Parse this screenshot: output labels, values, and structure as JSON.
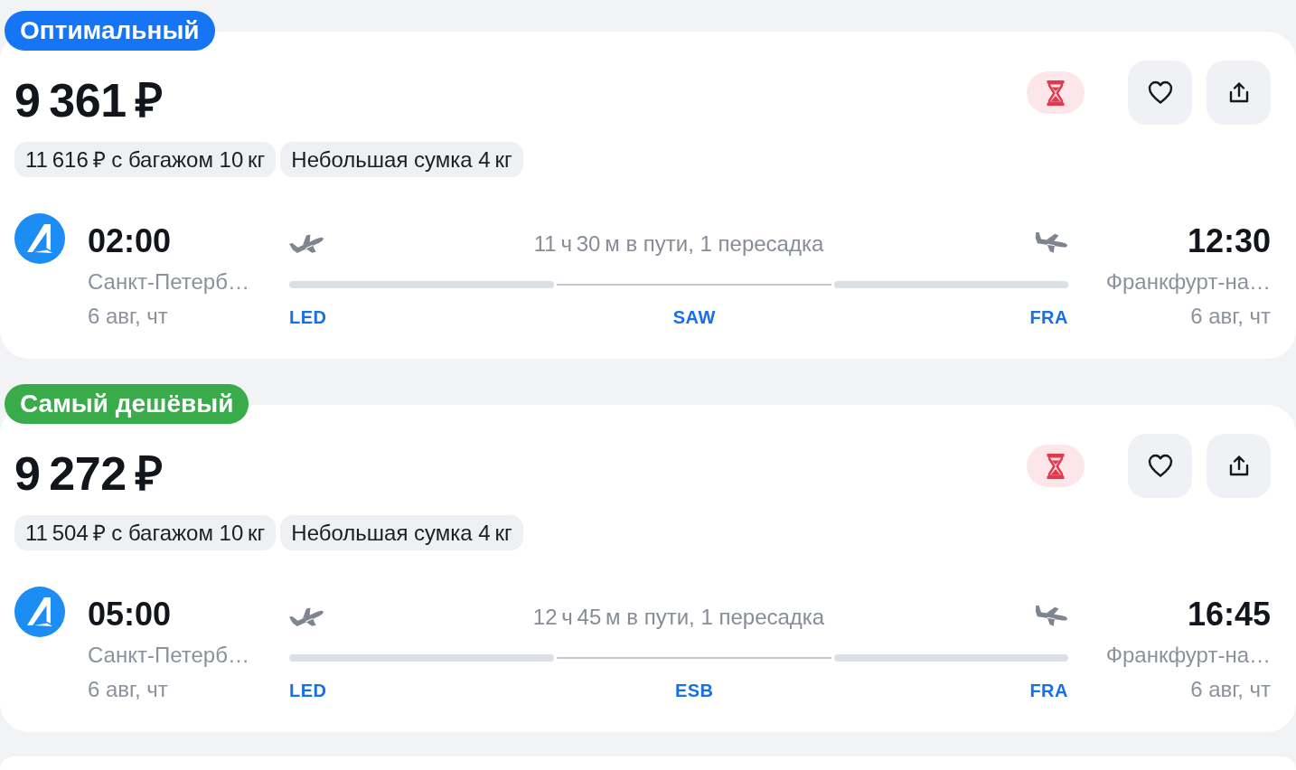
{
  "offers": [
    {
      "badge": {
        "label": "Оптимальный",
        "color": "#1575f5"
      },
      "price": "9 361 ₽",
      "chips": [
        "11 616 ₽ с багажом 10 кг",
        "Небольшая сумка 4 кг"
      ],
      "flight": {
        "departure": {
          "time": "02:00",
          "city": "Санкт-Петерб…",
          "date": "6 авг, чт"
        },
        "duration": "11 ч 30 м в пути, 1 пересадка",
        "route": {
          "departure_code": "LED",
          "transfer_code": "SAW",
          "arrival_code": "FRA"
        },
        "arrival": {
          "time": "12:30",
          "city": "Франкфурт-на…",
          "date": "6 авг, чт"
        }
      }
    },
    {
      "badge": {
        "label": "Самый дешёвый",
        "color": "#3aab4b"
      },
      "price": "9 272 ₽",
      "chips": [
        "11 504 ₽ с багажом 10 кг",
        "Небольшая сумка 4 кг"
      ],
      "flight": {
        "departure": {
          "time": "05:00",
          "city": "Санкт-Петерб…",
          "date": "6 авг, чт"
        },
        "duration": "12 ч 45 м в пути, 1 пересадка",
        "route": {
          "departure_code": "LED",
          "transfer_code": "ESB",
          "arrival_code": "FRA"
        },
        "arrival": {
          "time": "16:45",
          "city": "Франкфурт-на…",
          "date": "6 авг, чт"
        }
      }
    }
  ]
}
